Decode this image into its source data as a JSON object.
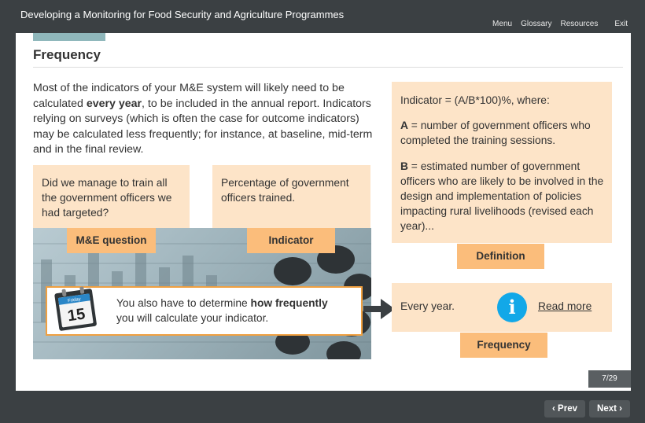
{
  "app": {
    "title": "Developing a Monitoring for Food Security and Agriculture Programmes",
    "nav": {
      "menu": "Menu",
      "glossary": "Glossary",
      "resources": "Resources",
      "exit": "Exit"
    }
  },
  "slide": {
    "heading": "Frequency",
    "intro": {
      "part1": "Most of the indicators of your M&E system will likely need to be calculated ",
      "bold": "every year",
      "part2": ", to be included in the annual report. Indicators relying on surveys (which is often the case for outcome indicators) may be calculated less frequently; for instance, at baseline, mid-term and in the final review."
    },
    "question_box": {
      "text": "Did we manage to train all the government officers we had targeted?",
      "tag": "M&E question"
    },
    "indicator_box": {
      "text": "Percentage of government officers trained.",
      "tag": "Indicator"
    },
    "callout": {
      "calendar_top": "Friday",
      "calendar_day": "15",
      "part1": "You also have to determine ",
      "bold": "how frequently",
      "part2": " you will calculate your indicator."
    },
    "definition": {
      "line1": "Indicator = (A/B*100)%, where:",
      "a_label": "A",
      "a_text": " = number of government officers who completed the training sessions.",
      "b_label": "B",
      "b_text": " = estimated number of government officers who are likely to be involved in the design and implementation of policies impacting rural livelihoods (revised each year)...",
      "tag": "Definition"
    },
    "frequency": {
      "text": "Every year.",
      "info_glyph": "i",
      "read_more": "Read more",
      "tag": "Frequency"
    },
    "page_counter": "7/29"
  },
  "footer": {
    "prev": "Prev",
    "next": "Next"
  },
  "colors": {
    "accent_peach": "#fde4c8",
    "tag_orange": "#fbbd7b",
    "info_blue": "#12a8e8",
    "chrome": "#3b4043"
  },
  "icons": {
    "prev": "chevron-left-icon",
    "next": "chevron-right-icon",
    "calendar": "calendar-icon",
    "info": "info-icon",
    "arrow": "arrow-right-icon"
  }
}
